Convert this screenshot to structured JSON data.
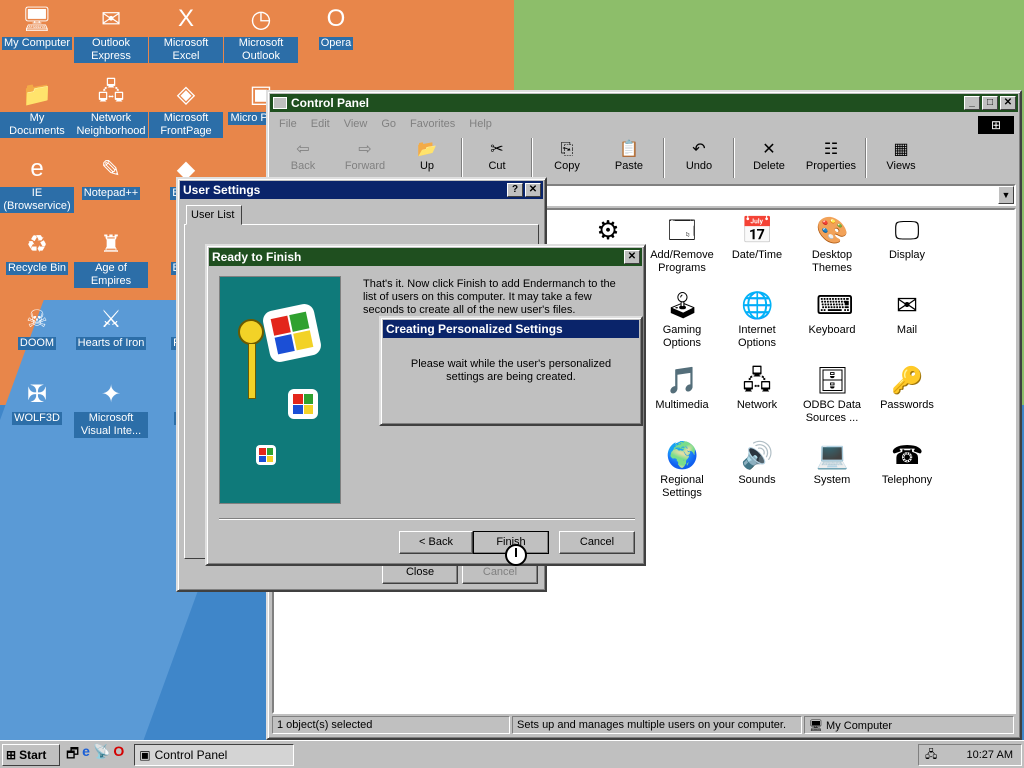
{
  "desktop_icons": [
    {
      "label": "My Computer",
      "icon": "my-computer-icon",
      "glyph": "🖥"
    },
    {
      "label": "Outlook Express",
      "icon": "outlook-express-icon",
      "glyph": "✉"
    },
    {
      "label": "Microsoft Excel",
      "icon": "excel-icon",
      "glyph": "X"
    },
    {
      "label": "Microsoft Outlook",
      "icon": "outlook-icon",
      "glyph": "◷"
    },
    {
      "label": "Opera",
      "icon": "opera-icon",
      "glyph": "O"
    },
    {
      "label": "My Documents",
      "icon": "my-documents-icon",
      "glyph": "📁"
    },
    {
      "label": "Network Neighborhood",
      "icon": "network-neighborhood-icon",
      "glyph": "🖧"
    },
    {
      "label": "Microsoft FrontPage",
      "icon": "frontpage-icon",
      "glyph": "◈"
    },
    {
      "label": "Micro Power",
      "icon": "powerpoint-icon",
      "glyph": "▣"
    },
    {
      "label": "IE (Browservice)",
      "icon": "internet-explorer-icon",
      "glyph": "e"
    },
    {
      "label": "Notepad++",
      "icon": "notepadpp-icon",
      "glyph": "✎"
    },
    {
      "label": "Bet D",
      "icon": "app-icon",
      "glyph": "◆"
    },
    {
      "label": "Recycle Bin",
      "icon": "recycle-bin-icon",
      "glyph": "♻"
    },
    {
      "label": "Age of Empires",
      "icon": "age-of-empires-icon",
      "glyph": "♜"
    },
    {
      "label": "Big D",
      "icon": "app-icon",
      "glyph": "◆"
    },
    {
      "label": "DOOM",
      "icon": "doom-icon",
      "glyph": "☠"
    },
    {
      "label": "Hearts of Iron",
      "icon": "hearts-of-iron-icon",
      "glyph": "⚔"
    },
    {
      "label": "Pagg",
      "icon": "app-icon",
      "glyph": "◆"
    },
    {
      "label": "WOLF3D",
      "icon": "wolf3d-icon",
      "glyph": "✠"
    },
    {
      "label": "Microsoft Visual Inte...",
      "icon": "visual-interdev-icon",
      "glyph": "✦"
    },
    {
      "label": "Pl Z",
      "icon": "app-icon",
      "glyph": "◆"
    }
  ],
  "control_panel": {
    "title": "Control Panel",
    "menu": [
      "File",
      "Edit",
      "View",
      "Go",
      "Favorites",
      "Help"
    ],
    "toolbar": [
      {
        "label": "Back",
        "glyph": "⇦",
        "disabled": true
      },
      {
        "label": "Forward",
        "glyph": "⇨",
        "disabled": true
      },
      {
        "label": "Up",
        "glyph": "📂",
        "disabled": false
      },
      {
        "label": "Cut",
        "glyph": "✂",
        "disabled": false
      },
      {
        "label": "Copy",
        "glyph": "⎘",
        "disabled": false
      },
      {
        "label": "Paste",
        "glyph": "📋",
        "disabled": false
      },
      {
        "label": "Undo",
        "glyph": "↶",
        "disabled": false
      },
      {
        "label": "Delete",
        "glyph": "✕",
        "disabled": false
      },
      {
        "label": "Properties",
        "glyph": "☷",
        "disabled": false
      },
      {
        "label": "Views",
        "glyph": "▦",
        "disabled": false
      }
    ],
    "items": [
      {
        "label": "Add/Remove Programs",
        "glyph": "🗔"
      },
      {
        "label": "Date/Time",
        "glyph": "📅"
      },
      {
        "label": "Desktop Themes",
        "glyph": "🎨"
      },
      {
        "label": "Display",
        "glyph": "🖵"
      },
      {
        "label": "Gaming Options",
        "glyph": "🕹"
      },
      {
        "label": "Internet Options",
        "glyph": "🌐"
      },
      {
        "label": "Keyboard",
        "glyph": "⌨"
      },
      {
        "label": "Mail",
        "glyph": "✉"
      },
      {
        "label": "Multimedia",
        "glyph": "🎵"
      },
      {
        "label": "Network",
        "glyph": "🖧"
      },
      {
        "label": "ODBC Data Sources ...",
        "glyph": "🗄"
      },
      {
        "label": "Passwords",
        "glyph": "🔑"
      },
      {
        "label": "Regional Settings",
        "glyph": "🌍"
      },
      {
        "label": "Sounds",
        "glyph": "🔊"
      },
      {
        "label": "System",
        "glyph": "💻"
      },
      {
        "label": "Telephony",
        "glyph": "☎"
      }
    ],
    "status": {
      "selected": "1 object(s) selected",
      "description": "Sets up and manages multiple users on your computer.",
      "location": "My Computer"
    }
  },
  "user_settings": {
    "title": "User Settings",
    "tab": "User List",
    "close_label": "Close",
    "cancel_label": "Cancel",
    "help_glyph": "?",
    "close_glyph": "✕"
  },
  "ready_dialog": {
    "title": "Ready to Finish",
    "text": "That's it. Now click Finish to add Endermanch to the list of users on this computer. It may take a few seconds to create all of the new user's files.",
    "back_label": "< Back",
    "finish_label": "Finish",
    "cancel_label": "Cancel"
  },
  "progress_dialog": {
    "title": "Creating Personalized Settings",
    "text": "Please wait while the user's personalized settings are being created."
  },
  "taskbar": {
    "start_label": "Start",
    "task_label": "Control Panel",
    "clock": "10:27 AM"
  }
}
